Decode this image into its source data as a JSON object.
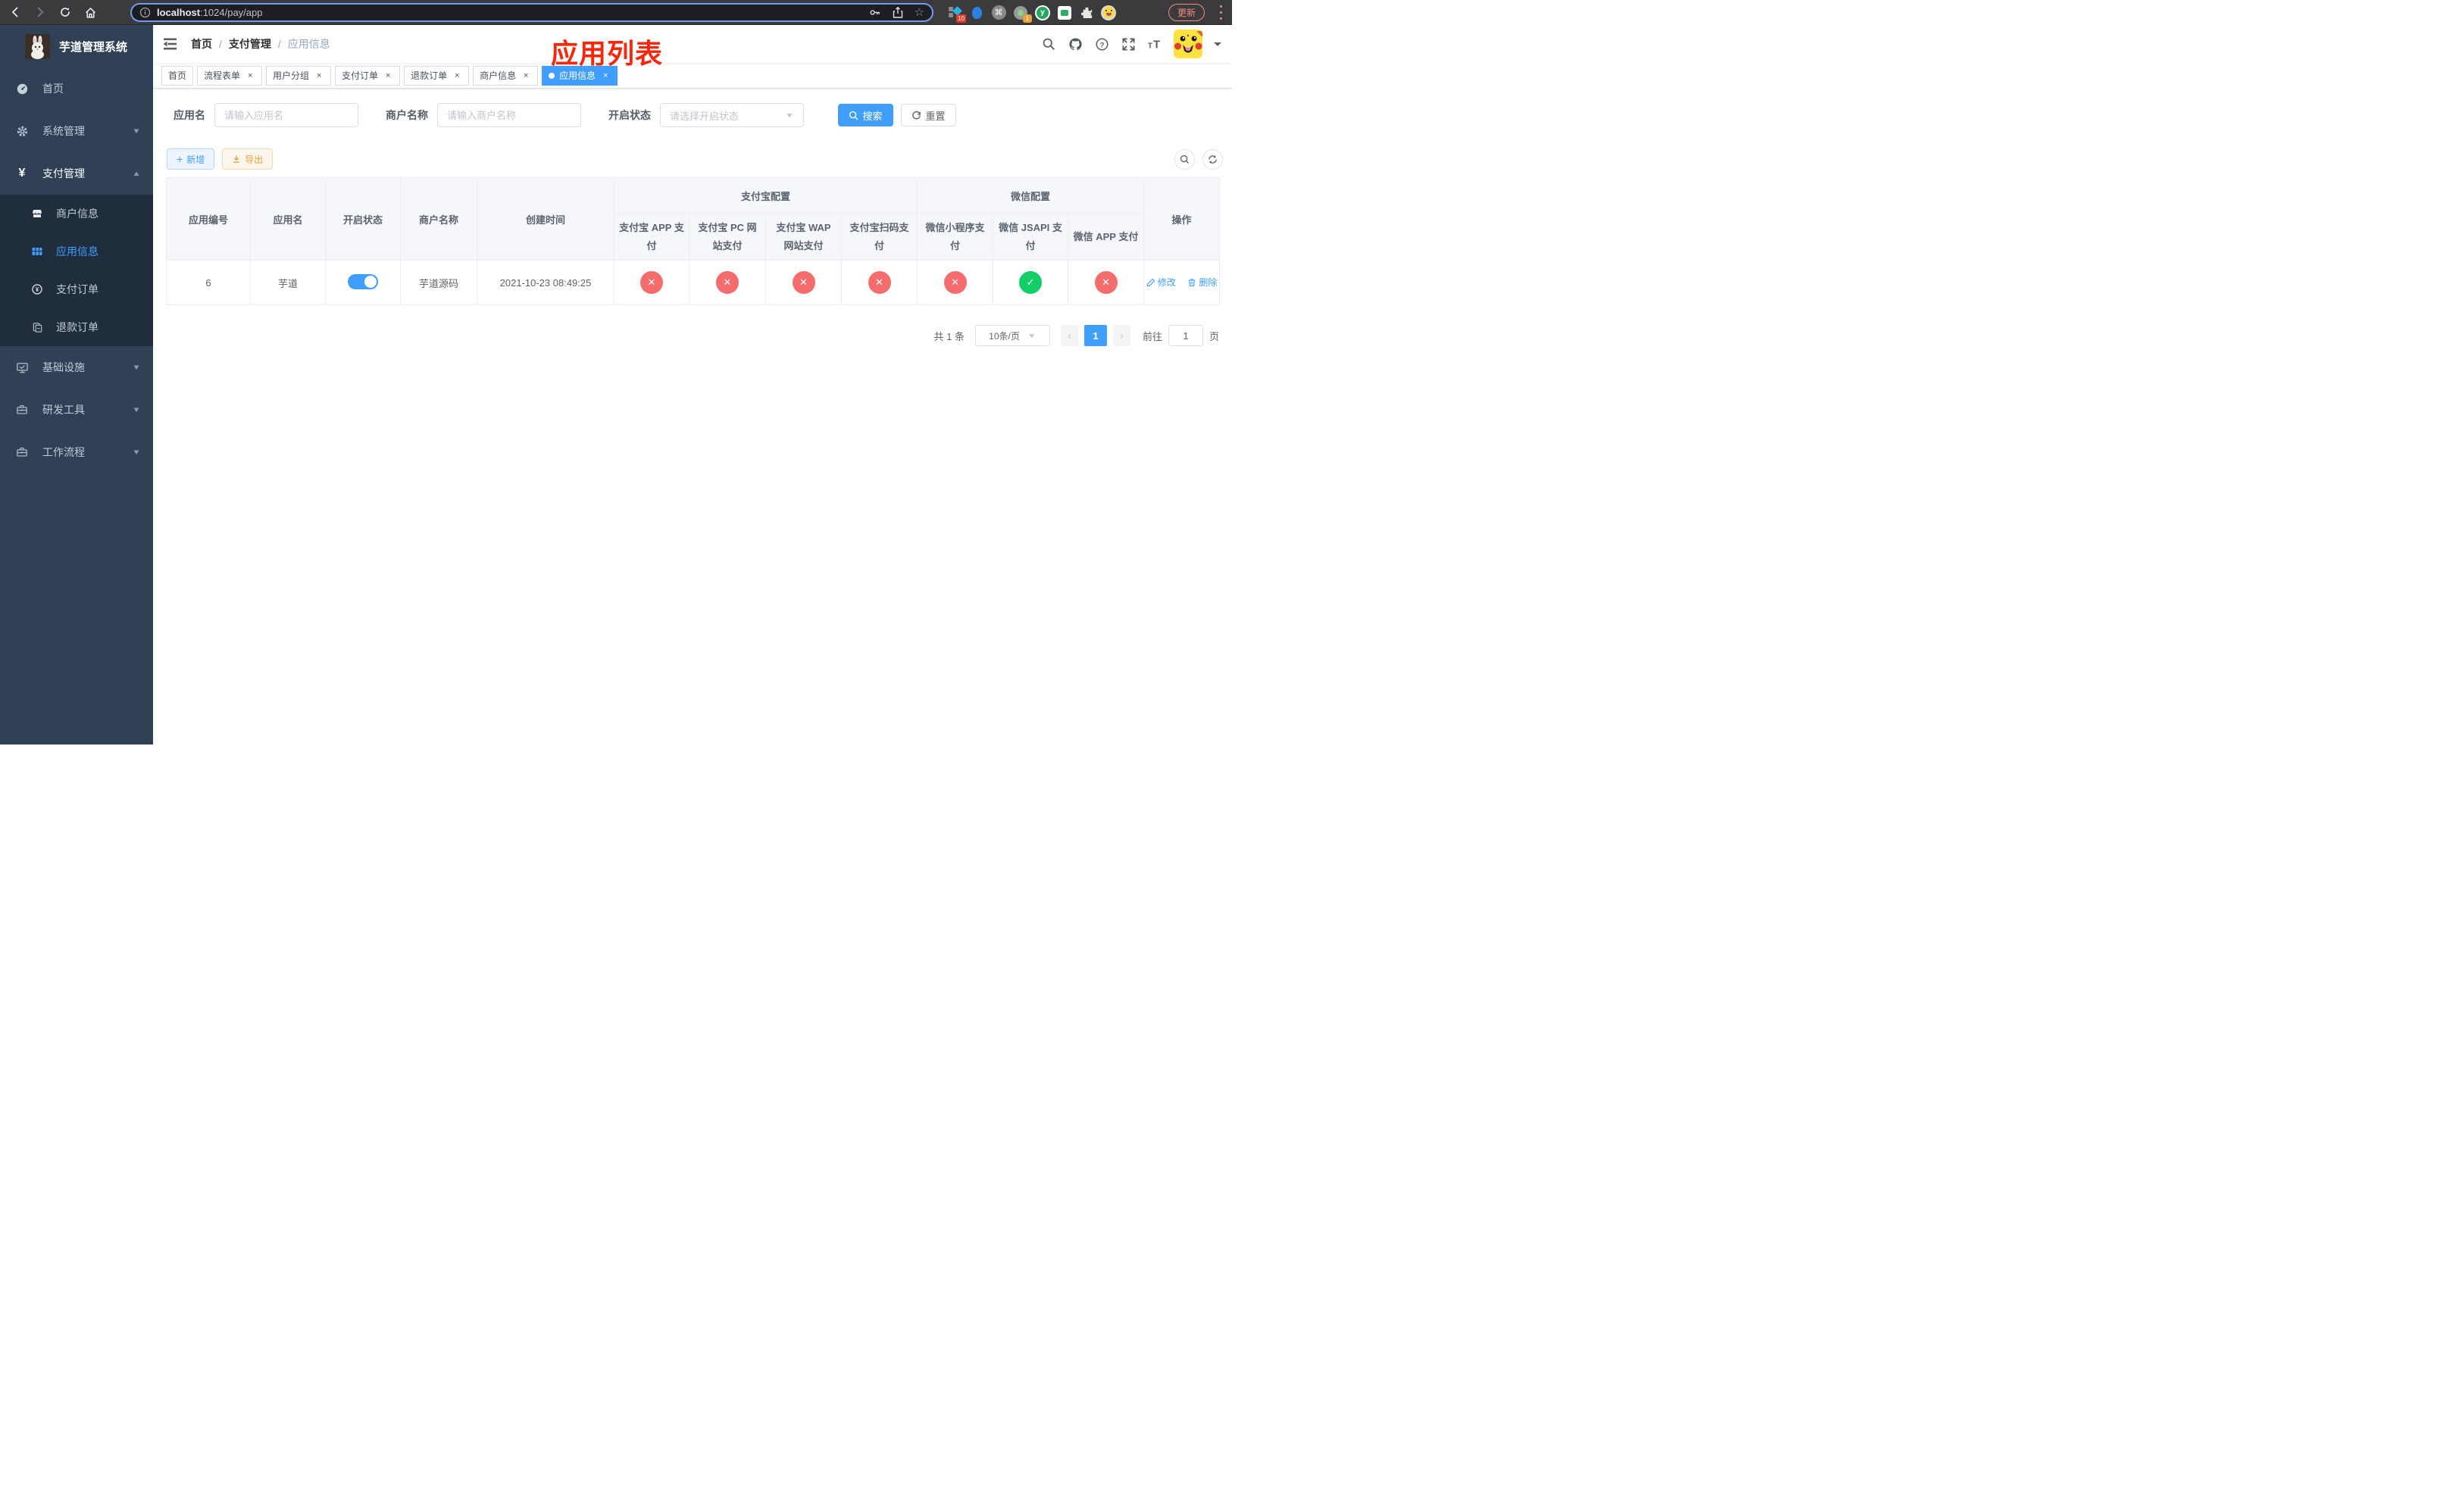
{
  "browser": {
    "url_host": "localhost",
    "url_rest": ":1024/pay/app",
    "update_button": "更新",
    "extension_badge_a": "10",
    "extension_badge_b": "1"
  },
  "sidebar": {
    "title": "芋道管理系统",
    "menu": [
      {
        "label": "首页",
        "icon": "dashboard-icon"
      },
      {
        "label": "系统管理",
        "icon": "gear-icon"
      },
      {
        "label": "支付管理",
        "icon": "yen-icon"
      }
    ],
    "submenu": [
      {
        "label": "商户信息",
        "icon": "shop-icon"
      },
      {
        "label": "应用信息",
        "icon": "grid-icon"
      },
      {
        "label": "支付订单",
        "icon": "pay-order-icon"
      },
      {
        "label": "退款订单",
        "icon": "refund-icon"
      }
    ],
    "menu_lower": [
      {
        "label": "基础设施",
        "icon": "monitor-icon"
      },
      {
        "label": "研发工具",
        "icon": "toolbox-icon"
      },
      {
        "label": "工作流程",
        "icon": "toolbox-icon"
      }
    ]
  },
  "navbar": {
    "breadcrumb": [
      {
        "label": "首页"
      },
      {
        "label": "支付管理"
      },
      {
        "label": "应用信息"
      }
    ]
  },
  "annotation": {
    "text": "应用列表",
    "color": "#f8270b"
  },
  "tags": [
    {
      "label": "首页",
      "closable": false,
      "active": false
    },
    {
      "label": "流程表单",
      "closable": true,
      "active": false
    },
    {
      "label": "用户分组",
      "closable": true,
      "active": false
    },
    {
      "label": "支付订单",
      "closable": true,
      "active": false
    },
    {
      "label": "退款订单",
      "closable": true,
      "active": false
    },
    {
      "label": "商户信息",
      "closable": true,
      "active": false
    },
    {
      "label": "应用信息",
      "closable": true,
      "active": true
    }
  ],
  "filters": {
    "app_name_label": "应用名",
    "app_name_placeholder": "请输入应用名",
    "merchant_label": "商户名称",
    "merchant_placeholder": "请输入商户名称",
    "status_label": "开启状态",
    "status_placeholder": "请选择开启状态",
    "search_button": "搜索",
    "reset_button": "重置"
  },
  "toolbar": {
    "add_button": "新增",
    "export_button": "导出"
  },
  "table": {
    "col_id": "应用编号",
    "col_name": "应用名",
    "col_status": "开启状态",
    "col_merchant": "商户名称",
    "col_created": "创建时间",
    "group_alipay": "支付宝配置",
    "group_wechat": "微信配置",
    "alipay_cols": [
      "支付宝 APP 支付",
      "支付宝 PC 网站支付",
      "支付宝 WAP 网站支付",
      "支付宝扫码支付"
    ],
    "wechat_cols": [
      "微信小程序支付",
      "微信 JSAPI 支付",
      "微信 APP 支付"
    ],
    "col_actions": "操作",
    "row": {
      "id": "6",
      "name": "芋道",
      "enabled": "on",
      "merchant": "芋道源码",
      "created": "2021-10-23 08:49:25",
      "statuses": [
        "fail",
        "fail",
        "fail",
        "fail",
        "fail",
        "success",
        "fail"
      ],
      "edit": "修改",
      "delete": "删除"
    }
  },
  "pagination": {
    "total": "共 1 条",
    "page_size": "10条/页",
    "page": "1",
    "goto_label": "前往",
    "goto_value": "1",
    "page_unit": "页"
  },
  "colors": {
    "accent": "#409eff",
    "danger": "#f56c6c",
    "success": "#13ce66",
    "warning": "#e6a23c",
    "sidebar_bg": "#304156",
    "submenu_bg": "#1f2d3d"
  }
}
